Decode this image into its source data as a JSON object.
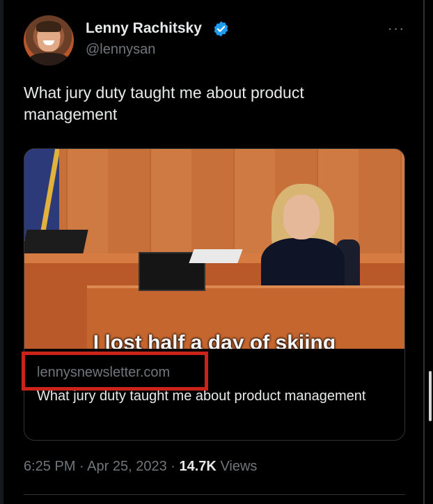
{
  "author": {
    "name": "Lenny Rachitsky",
    "handle": "@lennysan",
    "verified_color": "#1d9bf0"
  },
  "more_icon": "···",
  "tweet": {
    "text": "What jury duty taught me about product management"
  },
  "card": {
    "image_caption": "I lost half a day of skiing",
    "domain": "lennysnewsletter.com",
    "title": "What jury duty taught me about product management",
    "highlight_color": "#c9231a"
  },
  "meta": {
    "time": "6:25 PM",
    "separator": "·",
    "date": "Apr 25, 2023",
    "views_count": "14.7K",
    "views_label": "Views"
  },
  "colors": {
    "background": "#000000",
    "primary_text": "#e7e9ea",
    "secondary_text": "#71767b",
    "border": "#2f3336"
  }
}
